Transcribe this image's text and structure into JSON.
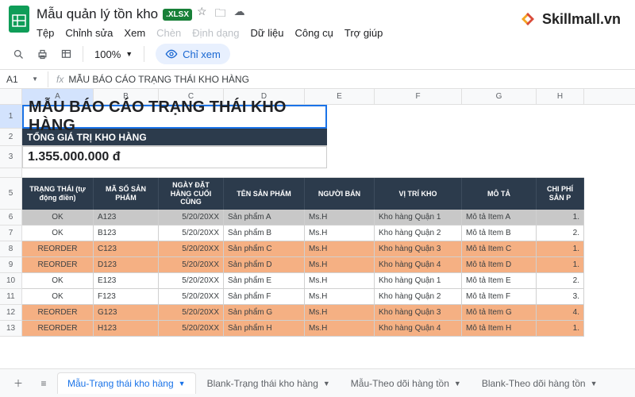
{
  "doc": {
    "title": "Mẫu quản lý tồn kho",
    "badge": ".XLSX"
  },
  "menus": [
    "Tệp",
    "Chỉnh sửa",
    "Xem",
    "Chèn",
    "Định dạng",
    "Dữ liệu",
    "Công cụ",
    "Trợ giúp"
  ],
  "menu_disabled": [
    3,
    4
  ],
  "brand": "Skillmall.vn",
  "toolbar": {
    "zoom": "100%",
    "view_only": "Chỉ xem"
  },
  "namebox": "A1",
  "formula": "MẪU BÁO CÁO TRẠNG THÁI KHO HÀNG",
  "cols": [
    "A",
    "B",
    "C",
    "D",
    "E",
    "F",
    "G",
    "H"
  ],
  "rows": [
    "1",
    "2",
    "3",
    "",
    "5",
    "6",
    "7",
    "8",
    "9",
    "10",
    "11",
    "12",
    "13"
  ],
  "sheet": {
    "title": "MẪU BÁO CÁO TRẠNG THÁI KHO HÀNG",
    "subhead": "TỔNG GIÁ TRỊ KHO HÀNG",
    "total": "1.355.000.000 đ",
    "headers": [
      "TRẠNG THÁI (tự động điền)",
      "MÃ SỐ SẢN PHẨM",
      "NGÀY ĐẶT HÀNG CUỐI CÙNG",
      "TÊN SẢN PHẨM",
      "NGƯỜI BÁN",
      "VỊ TRÍ KHO",
      "MÔ TẢ",
      "CHI PHÍ SẢN P"
    ],
    "data": [
      {
        "status": "OK",
        "sku": "A123",
        "date": "5/20/20XX",
        "name": "Sản phẩm A",
        "seller": "Ms.H",
        "loc": "Kho hàng Quận 1",
        "desc": "Mô tả Item A",
        "cost": "1.",
        "cls": "gray"
      },
      {
        "status": "OK",
        "sku": "B123",
        "date": "5/20/20XX",
        "name": "Sản phẩm B",
        "seller": "Ms.H",
        "loc": "Kho hàng Quận 2",
        "desc": "Mô tả Item B",
        "cost": "2.",
        "cls": ""
      },
      {
        "status": "REORDER",
        "sku": "C123",
        "date": "5/20/20XX",
        "name": "Sản phẩm C",
        "seller": "Ms.H",
        "loc": "Kho hàng Quận 3",
        "desc": "Mô tả Item C",
        "cost": "1.",
        "cls": "orange"
      },
      {
        "status": "REORDER",
        "sku": "D123",
        "date": "5/20/20XX",
        "name": "Sản phẩm D",
        "seller": "Ms.H",
        "loc": "Kho hàng Quận 4",
        "desc": "Mô tả Item D",
        "cost": "1.",
        "cls": "orange"
      },
      {
        "status": "OK",
        "sku": "E123",
        "date": "5/20/20XX",
        "name": "Sản phẩm E",
        "seller": "Ms.H",
        "loc": "Kho hàng Quận 1",
        "desc": "Mô tả Item E",
        "cost": "2.",
        "cls": ""
      },
      {
        "status": "OK",
        "sku": "F123",
        "date": "5/20/20XX",
        "name": "Sản phẩm F",
        "seller": "Ms.H",
        "loc": "Kho hàng Quận 2",
        "desc": "Mô tả Item F",
        "cost": "3.",
        "cls": ""
      },
      {
        "status": "REORDER",
        "sku": "G123",
        "date": "5/20/20XX",
        "name": "Sản phẩm G",
        "seller": "Ms.H",
        "loc": "Kho hàng Quận 3",
        "desc": "Mô tả Item G",
        "cost": "4.",
        "cls": "orange"
      },
      {
        "status": "REORDER",
        "sku": "H123",
        "date": "5/20/20XX",
        "name": "Sản phẩm H",
        "seller": "Ms.H",
        "loc": "Kho hàng Quận 4",
        "desc": "Mô tả Item H",
        "cost": "1.",
        "cls": "orange"
      }
    ]
  },
  "tabs": [
    "Mẫu-Trạng thái kho hàng",
    "Blank-Trạng thái kho hàng",
    "Mẫu-Theo dõi hàng tồn",
    "Blank-Theo dõi hàng tồn"
  ]
}
